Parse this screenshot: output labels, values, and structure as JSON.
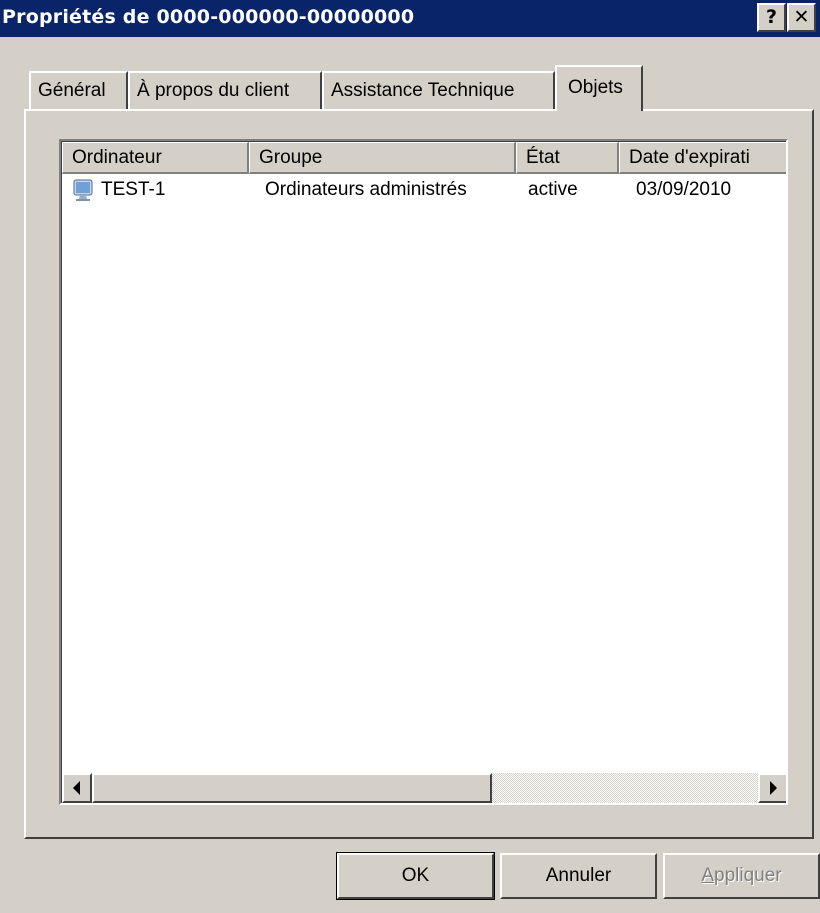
{
  "window": {
    "title": "Propriétés de 0000-000000-00000000",
    "help_button": "?",
    "close_button": "✕"
  },
  "tabs": [
    {
      "label": "Général",
      "active": false
    },
    {
      "label": "À propos du client",
      "active": false
    },
    {
      "label": "Assistance Technique",
      "active": false
    },
    {
      "label": "Objets",
      "active": true
    }
  ],
  "list": {
    "columns": [
      "Ordinateur",
      "Groupe",
      "État",
      "Date d'expirati"
    ],
    "rows": [
      {
        "icon": "computer-icon",
        "name": "TEST-1",
        "group": "Ordinateurs administrés",
        "state": "active",
        "expiration": "03/09/2010"
      }
    ]
  },
  "buttons": {
    "ok": "OK",
    "cancel": "Annuler",
    "apply_first": "A",
    "apply_rest": "ppliquer"
  },
  "colors": {
    "titlebar": "#0a246a",
    "face": "#d4d0c8",
    "disabled_text": "#808080"
  }
}
